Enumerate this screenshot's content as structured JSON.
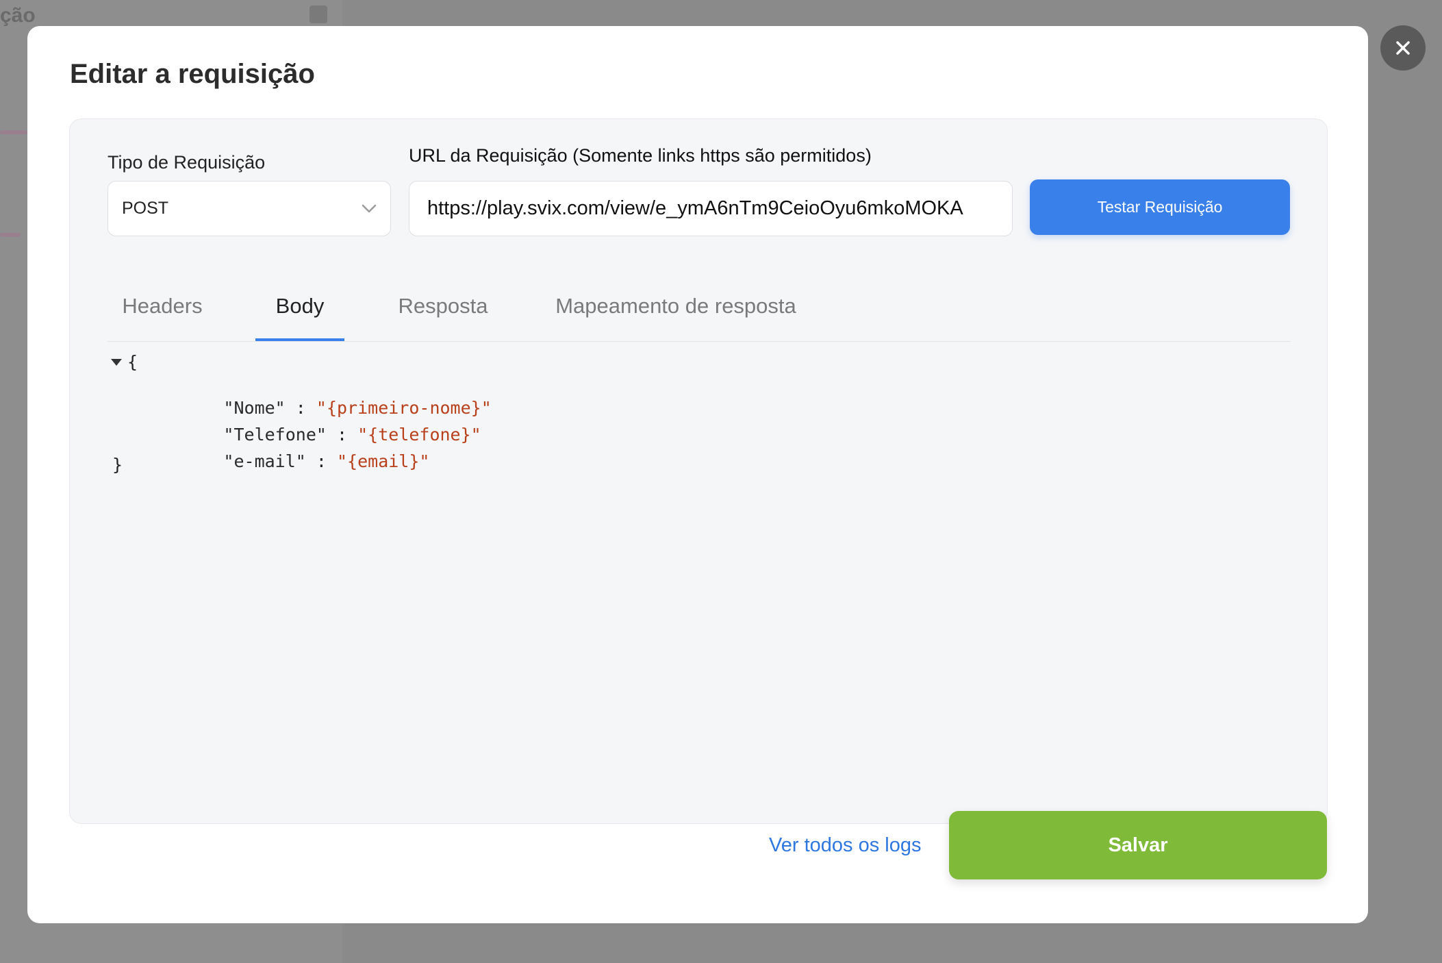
{
  "background": {
    "title_fragment": "ção"
  },
  "modal": {
    "title": "Editar a requisição",
    "close_icon": "close-icon"
  },
  "form": {
    "type_label": "Tipo de Requisição",
    "type_value": "POST",
    "url_label": "URL da Requisição (Somente links https são permitidos)",
    "url_value": "https://play.svix.com/view/e_ymA6nTm9CeioOyu6mkoMOKA",
    "test_button": "Testar Requisição"
  },
  "tabs": {
    "items": [
      {
        "label": "Headers"
      },
      {
        "label": "Body"
      },
      {
        "label": "Resposta"
      },
      {
        "label": "Mapeamento de resposta"
      }
    ],
    "active": "Body"
  },
  "body_json": {
    "open_brace": "{",
    "close_brace": "}",
    "entries": [
      {
        "key": "\"Nome\"",
        "value": "\"{primeiro-nome}\""
      },
      {
        "key": "\"Telefone\"",
        "value": "\"{telefone}\""
      },
      {
        "key": "\"e-mail\"",
        "value": "\"{email}\""
      }
    ]
  },
  "footer": {
    "logs_link": "Ver todos os logs",
    "save_button": "Salvar"
  },
  "colors": {
    "primary_blue": "#3a80ea",
    "save_green": "#7fba39",
    "json_string": "#b8401a"
  }
}
